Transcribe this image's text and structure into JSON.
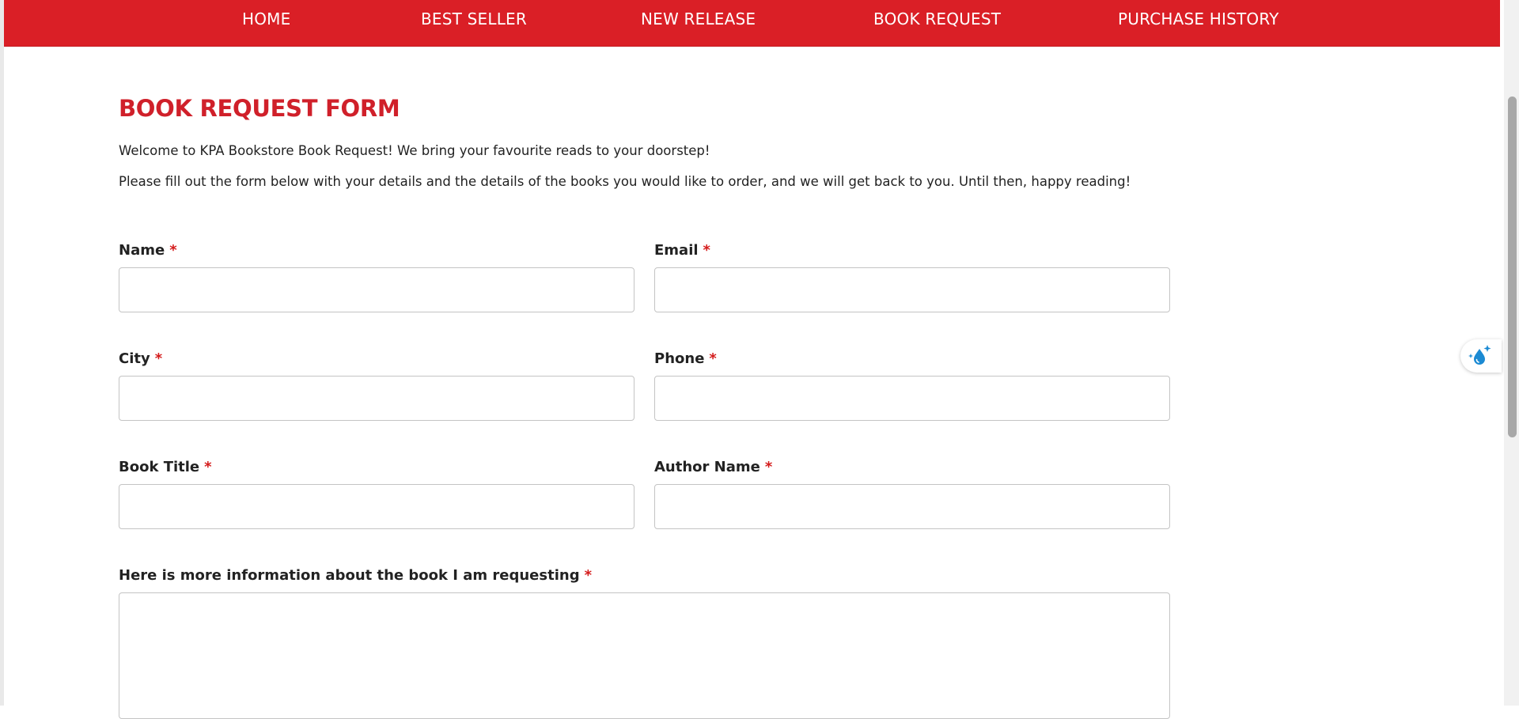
{
  "nav": {
    "items": [
      {
        "label": "HOME"
      },
      {
        "label": "BEST SELLER"
      },
      {
        "label": "NEW RELEASE"
      },
      {
        "label": "BOOK REQUEST"
      },
      {
        "label": "PURCHASE HISTORY"
      }
    ]
  },
  "form": {
    "title": "BOOK REQUEST FORM",
    "intro_1": "Welcome to KPA Bookstore Book Request! We bring your favourite reads to your doorstep!",
    "intro_2": "Please fill out the form below with your details and the details of the books you would like to order, and we will get back to you. Until then, happy reading!",
    "required_marker": "*",
    "fields": {
      "name": {
        "label": "Name",
        "value": ""
      },
      "email": {
        "label": "Email",
        "value": ""
      },
      "city": {
        "label": "City",
        "value": ""
      },
      "phone": {
        "label": "Phone",
        "value": ""
      },
      "book_title": {
        "label": "Book Title",
        "value": ""
      },
      "author_name": {
        "label": "Author Name",
        "value": ""
      },
      "more_info": {
        "label": "Here is more information about the book I am requesting",
        "value": ""
      }
    }
  },
  "widget": {
    "icon": "water-drop-sparkle-icon"
  },
  "colors": {
    "brand_red": "#da1f26",
    "title_red": "#d0202a",
    "required_red": "#d41b1b"
  }
}
